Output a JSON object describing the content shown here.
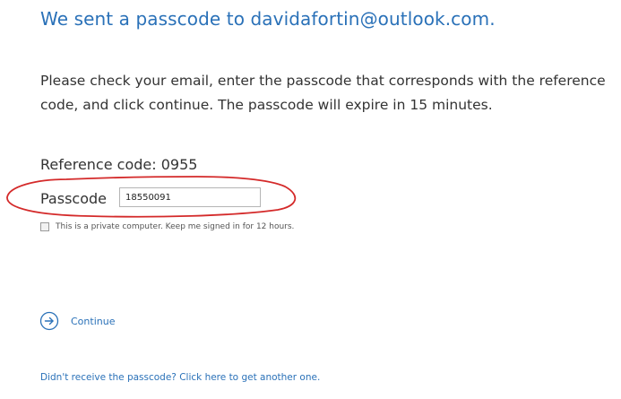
{
  "heading": "We sent a passcode to davidafortin@outlook.com.",
  "instructions": "Please check your email, enter the passcode that corresponds with the reference code, and click continue. The passcode will expire in 15 minutes.",
  "reference": "Reference code: 0955",
  "passcode": {
    "label": "Passcode",
    "value": "18550091"
  },
  "keep_signed_in": {
    "label": "This is a private computer. Keep me signed in for 12 hours.",
    "checked": false
  },
  "continue": {
    "label": "Continue",
    "icon": "arrow-right-circle-icon"
  },
  "resend_link": "Didn't receive the passcode? Click here to get another one.",
  "colors": {
    "link": "#2a71b8",
    "text": "#333333",
    "annotation": "#d42a2a"
  }
}
